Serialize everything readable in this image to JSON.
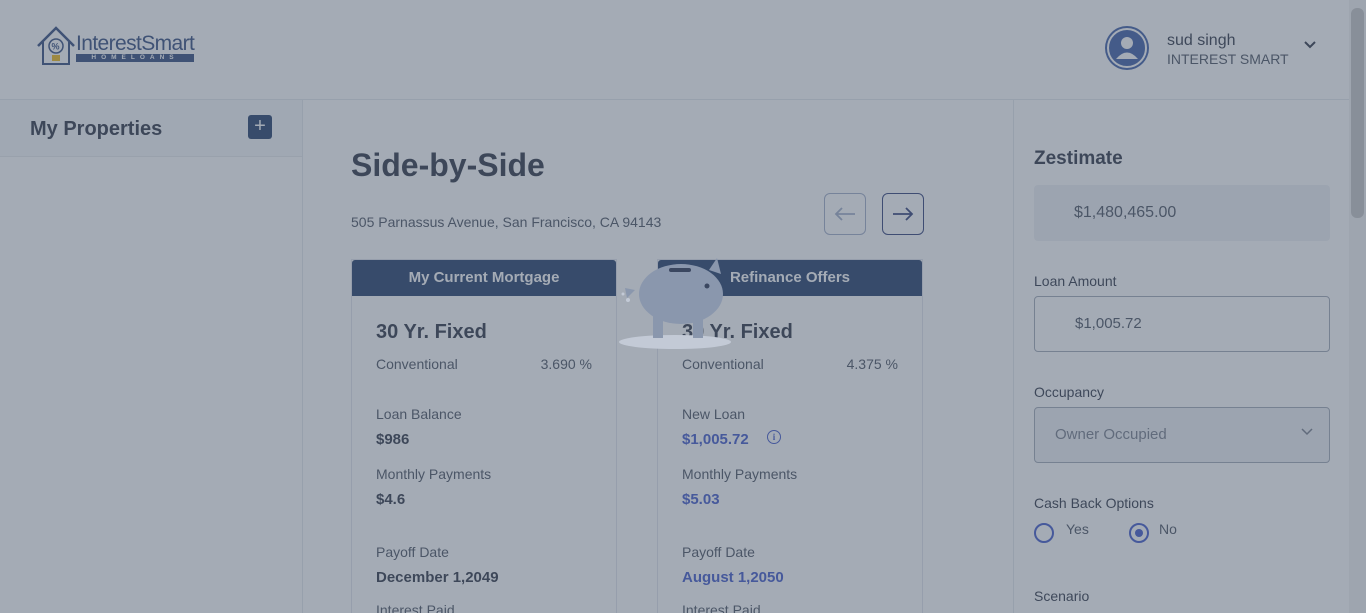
{
  "header": {
    "logo_text": "InterestSmart",
    "logo_subtext": "HOMELOANS",
    "user_name": "sud singh",
    "user_org": "INTEREST SMART",
    "avatar_icon": "user-avatar-icon",
    "menu_icon": "chevron-down-icon"
  },
  "sidebar": {
    "title": "My Properties",
    "add_label": "+"
  },
  "main": {
    "title": "Side-by-Side",
    "address": "505 Parnassus Avenue, San Francisco, CA 94143",
    "prev_icon": "arrow-left-icon",
    "next_icon": "arrow-right-icon",
    "current": {
      "header": "My Current Mortgage",
      "loan_type": "30 Yr. Fixed",
      "program": "Conventional",
      "rate": "3.690 %",
      "balance_label": "Loan Balance",
      "balance": "$986",
      "payments_label": "Monthly Payments",
      "payments": "$4.6",
      "payoff_label": "Payoff Date",
      "payoff": "December 1,2049",
      "interest_label": "Interest Paid"
    },
    "refinance": {
      "header": "Refinance Offers",
      "loan_type": "30 Yr. Fixed",
      "program": "Conventional",
      "rate": "4.375 %",
      "new_loan_label": "New Loan",
      "new_loan": "$1,005.72",
      "info_icon": "info-icon",
      "payments_label": "Monthly Payments",
      "payments": "$5.03",
      "payoff_label": "Payoff Date",
      "payoff": "August 1,2050",
      "interest_label": "Interest Paid"
    }
  },
  "right_panel": {
    "title": "Zestimate",
    "zestimate": "$1,480,465.00",
    "loan_amount_label": "Loan Amount",
    "loan_amount": "$1,005.72",
    "occupancy_label": "Occupancy",
    "occupancy": "Owner Occupied",
    "cash_back_label": "Cash Back Options",
    "cash_back_yes": "Yes",
    "cash_back_no": "No",
    "cash_back_selected": "No",
    "scenario_label": "Scenario"
  },
  "loading": {
    "icon": "piggy-bank-loading-icon"
  },
  "colors": {
    "brand_navy": "#0f2c5c",
    "accent_blue": "#2f49c6",
    "overlay": "rgba(90,102,120,0.55)"
  }
}
